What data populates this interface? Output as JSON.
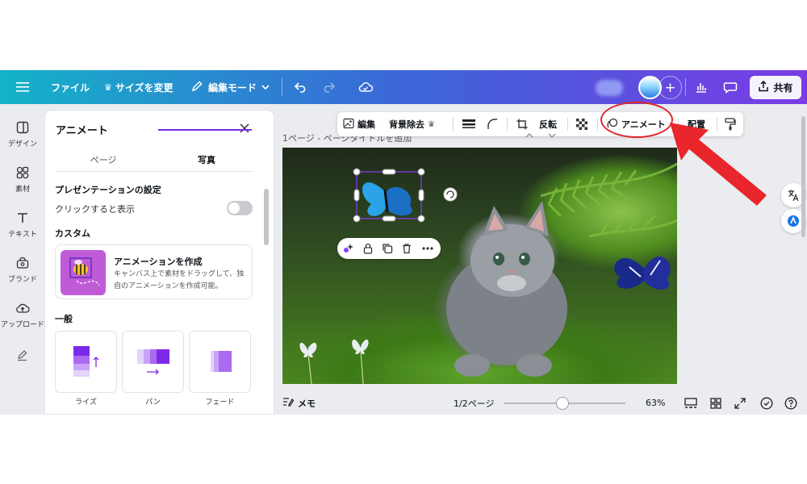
{
  "topbar": {
    "menu_icon": "hamburger-icon",
    "file_label": "ファイル",
    "resize_label": "サイズを変更",
    "edit_mode_label": "編集モード",
    "share_label": "共有"
  },
  "rail": {
    "items": [
      {
        "label": "デザイン",
        "icon": "design-icon"
      },
      {
        "label": "素材",
        "icon": "elements-icon"
      },
      {
        "label": "テキスト",
        "icon": "text-icon"
      },
      {
        "label": "ブランド",
        "icon": "brand-icon"
      },
      {
        "label": "アップロード",
        "icon": "upload-icon"
      }
    ]
  },
  "panel": {
    "title": "アニメート",
    "tabs": [
      {
        "label": "ページ",
        "active": false
      },
      {
        "label": "写真",
        "active": true
      }
    ],
    "presentation_heading": "プレゼンテーションの設定",
    "click_to_show_label": "クリックすると表示",
    "custom_heading": "カスタム",
    "create_card": {
      "title": "アニメーションを作成",
      "description": "キャンバス上で素材をドラッグして、独自のアニメーションを作成可能。"
    },
    "general_heading": "一般",
    "animations": [
      {
        "label": "ライズ"
      },
      {
        "label": "パン"
      },
      {
        "label": "フェード"
      }
    ]
  },
  "object_toolbar": {
    "edit_label": "編集",
    "bg_remove_label": "背景除去",
    "flip_label": "反転",
    "animate_label": "アニメート",
    "arrange_label": "配置"
  },
  "canvas": {
    "page_header": "1ページ - ページタイトルを追加"
  },
  "bottom_bar": {
    "notes_label": "メモ",
    "page_indicator": "1/2ページ",
    "zoom_label": "63%",
    "zoom_level": 0.63
  },
  "colors": {
    "accent": "#7d2ae8",
    "highlight": "#e0262b"
  }
}
